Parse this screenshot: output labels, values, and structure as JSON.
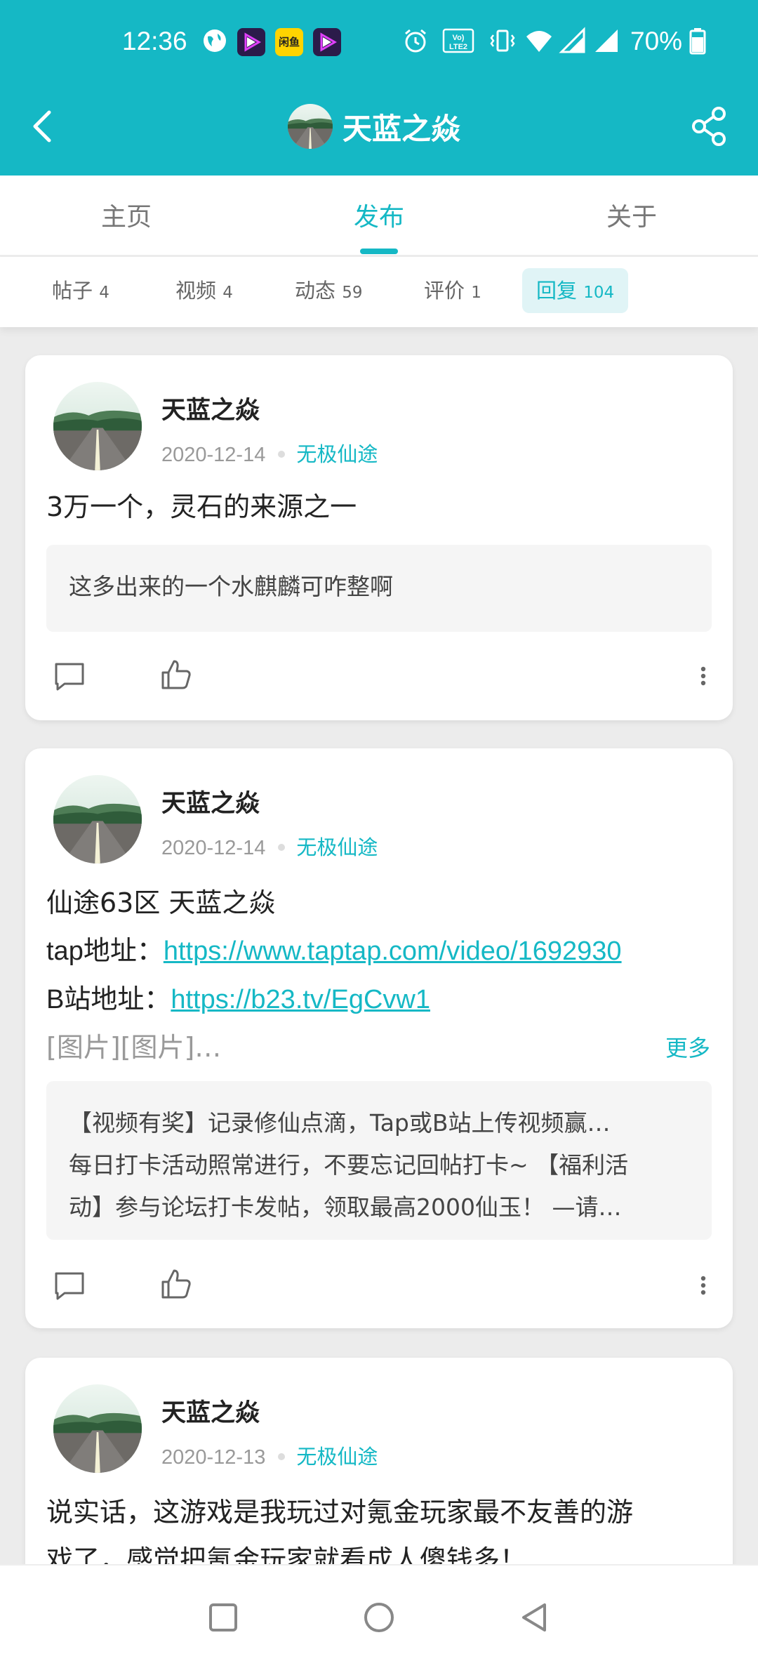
{
  "status_bar": {
    "time": "12:36",
    "battery": "70%",
    "app_badge_text": "闲鱼"
  },
  "header": {
    "title": "天蓝之焱"
  },
  "tabs": [
    {
      "label": "主页",
      "active": false
    },
    {
      "label": "发布",
      "active": true
    },
    {
      "label": "关于",
      "active": false
    }
  ],
  "subtabs": [
    {
      "label": "帖子",
      "count": "4",
      "active": false
    },
    {
      "label": "视频",
      "count": "4",
      "active": false
    },
    {
      "label": "动态",
      "count": "59",
      "active": false
    },
    {
      "label": "评价",
      "count": "1",
      "active": false
    },
    {
      "label": "回复",
      "count": "104",
      "active": true
    }
  ],
  "posts": [
    {
      "author": "天蓝之焱",
      "date": "2020-12-14",
      "game": "无极仙途",
      "text": "3万一个，灵石的来源之一",
      "quote": "这多出来的一个水麒麟可咋整啊"
    },
    {
      "author": "天蓝之焱",
      "date": "2020-12-14",
      "game": "无极仙途",
      "line1": "仙途63区 天蓝之焱",
      "line2_label": "tap地址：",
      "line2_link": "https://www.taptap.com/video/1692930",
      "line3_label": "B站地址：",
      "line3_link": "https://b23.tv/EgCvw1",
      "line4": "[图片][图片]…",
      "more": "更多",
      "quote_line1": "【视频有奖】记录修仙点滴，Tap或B站上传视频赢…",
      "quote_line2": "每日打卡活动照常进行，不要忘记回帖打卡~ 【福利活",
      "quote_line3": "动】参与论坛打卡发帖，领取最高2000仙玉！ —请…"
    },
    {
      "author": "天蓝之焱",
      "date": "2020-12-13",
      "game": "无极仙途",
      "line1": "说实话，这游戏是我玩过对氪金玩家最不友善的游",
      "line2": "戏了，感觉把氪金玩家就看成人傻钱多！"
    }
  ],
  "colors": {
    "accent": "#15b8c5",
    "background": "#ececec"
  }
}
